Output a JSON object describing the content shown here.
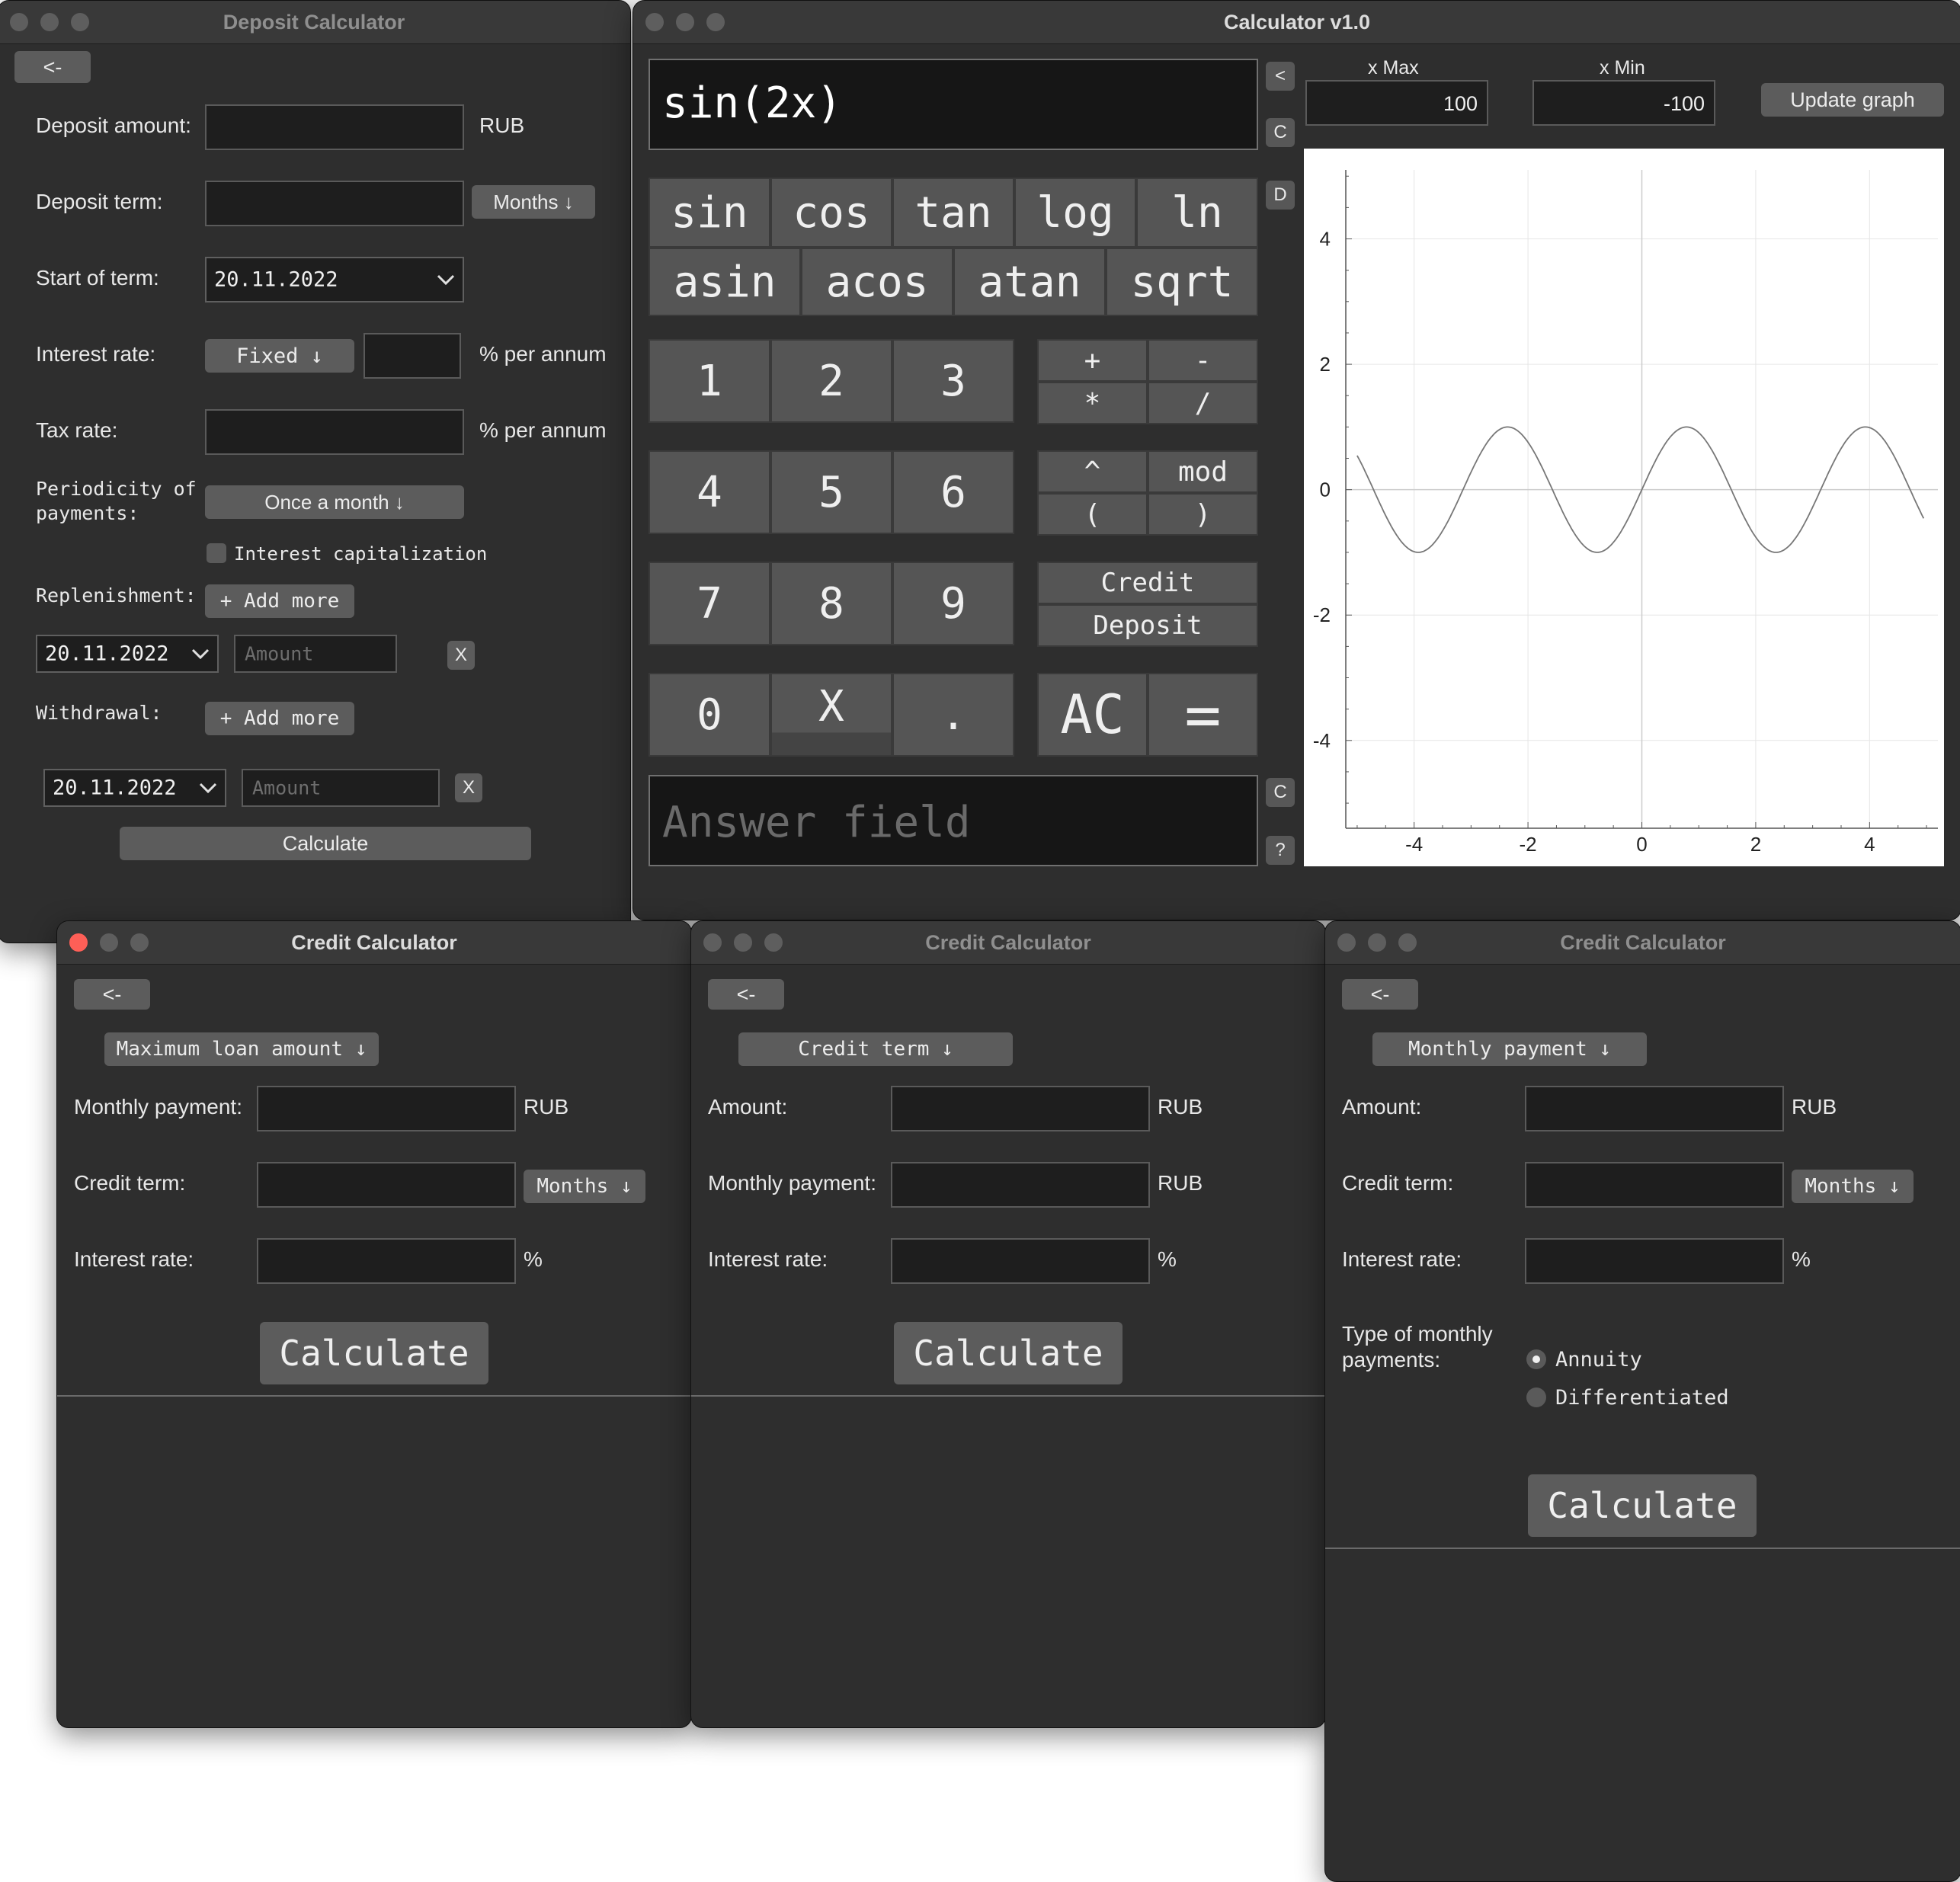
{
  "deposit": {
    "title": "Deposit Calculator",
    "back": "<-",
    "amount_label": "Deposit amount:",
    "amount_unit": "RUB",
    "term_label": "Deposit term:",
    "term_unit": "Months ↓",
    "start_label": "Start of term:",
    "start_value": "20.11.2022",
    "rate_label": "Interest rate:",
    "rate_type": "Fixed ↓",
    "rate_unit": "% per annum",
    "tax_label": "Tax rate:",
    "tax_unit": "% per annum",
    "period_label_1": "Periodicity of",
    "period_label_2": "payments:",
    "period_value": "Once a month ↓",
    "capitalization": "Interest capitalization",
    "replenishment_label": "Replenishment:",
    "add_more": "+ Add more",
    "repl_date": "20.11.2022",
    "amount_placeholder": "Amount",
    "remove": "X",
    "withdrawal_label": "Withdrawal:",
    "with_date": "20.11.2022",
    "calculate": "Calculate"
  },
  "calculator": {
    "title": "Calculator v1.0",
    "expression": "sin(2x)",
    "answer_placeholder": "Answer field",
    "side": {
      "back": "<",
      "clear": "C",
      "deg": "D",
      "clear2": "C",
      "help": "?"
    },
    "xmax_label": "x Max",
    "xmax_value": "100",
    "xmin_label": "x Min",
    "xmin_value": "-100",
    "update_graph": "Update graph",
    "functions_row1": [
      "sin",
      "cos",
      "tan",
      "log",
      "ln"
    ],
    "functions_row2": [
      "asin",
      "acos",
      "atan",
      "sqrt"
    ],
    "digits": [
      "1",
      "2",
      "3",
      "4",
      "5",
      "6",
      "7",
      "8",
      "9",
      "0",
      "X",
      "."
    ],
    "ops": {
      "plus": "+",
      "minus": "-",
      "mul": "*",
      "div": "/",
      "pow": "^",
      "mod": "mod",
      "lpar": "(",
      "rpar": ")",
      "credit": "Credit",
      "deposit": "Deposit",
      "ac": "AC",
      "eq": "="
    }
  },
  "chart_data": {
    "type": "line",
    "function": "sin(2x)",
    "x_ticks": [
      -4,
      -2,
      0,
      2,
      4
    ],
    "y_ticks": [
      4,
      2,
      0,
      -2,
      -4
    ],
    "xlim": [
      -5.2,
      5.2
    ],
    "ylim": [
      -5.4,
      5.1
    ],
    "grid": true,
    "series": [
      {
        "expression": "sin(2x)",
        "color": "#777777"
      }
    ]
  },
  "credit1": {
    "title": "Credit Calculator",
    "back": "<-",
    "mode": "Maximum loan amount ↓",
    "f1_label": "Monthly payment:",
    "f1_unit": "RUB",
    "f2_label": "Credit term:",
    "f2_unit": "Months ↓",
    "f3_label": "Interest rate:",
    "f3_unit": "%",
    "calculate": "Calculate"
  },
  "credit2": {
    "title": "Credit Calculator",
    "back": "<-",
    "mode": "Credit term ↓",
    "f1_label": "Amount:",
    "f1_unit": "RUB",
    "f2_label": "Monthly payment:",
    "f2_unit": "RUB",
    "f3_label": "Interest rate:",
    "f3_unit": "%",
    "calculate": "Calculate"
  },
  "credit3": {
    "title": "Credit Calculator",
    "back": "<-",
    "mode": "Monthly payment ↓",
    "f1_label": "Amount:",
    "f1_unit": "RUB",
    "f2_label": "Credit term:",
    "f2_unit": "Months ↓",
    "f3_label": "Interest rate:",
    "f3_unit": "%",
    "type_label_1": "Type of monthly",
    "type_label_2": "payments:",
    "opt_annuity": "Annuity",
    "opt_diff": "Differentiated",
    "calculate": "Calculate"
  }
}
